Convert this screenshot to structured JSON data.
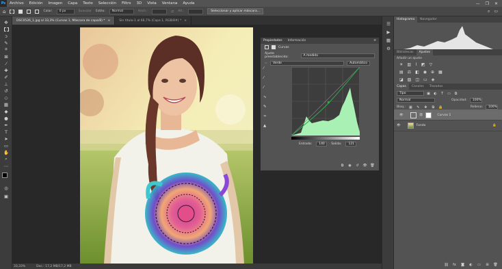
{
  "menubar": {
    "logo": "Ps",
    "items": [
      "Archivo",
      "Edición",
      "Imagen",
      "Capa",
      "Texto",
      "Selección",
      "Filtro",
      "3D",
      "Vista",
      "Ventana",
      "Ayuda"
    ],
    "window_buttons": [
      "—",
      "❐",
      "✕"
    ]
  },
  "options": {
    "feather_label": "Calar:",
    "feather_value": "0 px",
    "smooth_label": "Suavizar",
    "style_label": "Estilo:",
    "style_value": "Normal",
    "width_label": "Anch.:",
    "height_label": "Alt.:",
    "select_mask_button": "Seleccionar y aplicar máscara..."
  },
  "tabs": [
    {
      "label": "DSC0526_1.jpg al 33,3% (Curvas 1, Máscara de capa/8) *",
      "close": "×"
    },
    {
      "label": "Sin título-1 al 66,7% (Capa 1, RGB/8#) *",
      "close": "×"
    }
  ],
  "status": {
    "zoom": "33,33%",
    "doc": "Doc.: 17,2 MB/17,2 MB"
  },
  "properties": {
    "tab_properties": "Propiedades",
    "tab_info": "Información",
    "adjust_title": "Curvas",
    "preset_label": "Ajuste preestablecido:",
    "preset_value": "A medida",
    "channel_value": "Verde",
    "auto_button": "Automático",
    "input_label": "Entrada:",
    "input_value": "140",
    "output_label": "Salida:",
    "output_value": "121"
  },
  "histogram": {
    "tab_histogram": "Histograma",
    "tab_navigator": "Navegador"
  },
  "adjustments": {
    "tab_libraries": "Bibliotecas",
    "tab_adjustments": "Ajustes",
    "add_label": "Añadir un ajuste"
  },
  "layers": {
    "tab_layers": "Capas",
    "tab_channels": "Canales",
    "tab_paths": "Trazados",
    "filter_value": "Tipo",
    "blend_value": "Normal",
    "opacity_label": "Opacidad:",
    "opacity_value": "100%",
    "lock_label": "Bloq.:",
    "fill_label": "Relleno:",
    "fill_value": "100%",
    "items": [
      {
        "name": "Curvas 1",
        "selected": true
      },
      {
        "name": "Fondo",
        "selected": false
      }
    ]
  },
  "colors": {
    "accent": "#31a8ff",
    "curve_fill": "#a9f0b4",
    "curve_line": "#2ea94b"
  }
}
